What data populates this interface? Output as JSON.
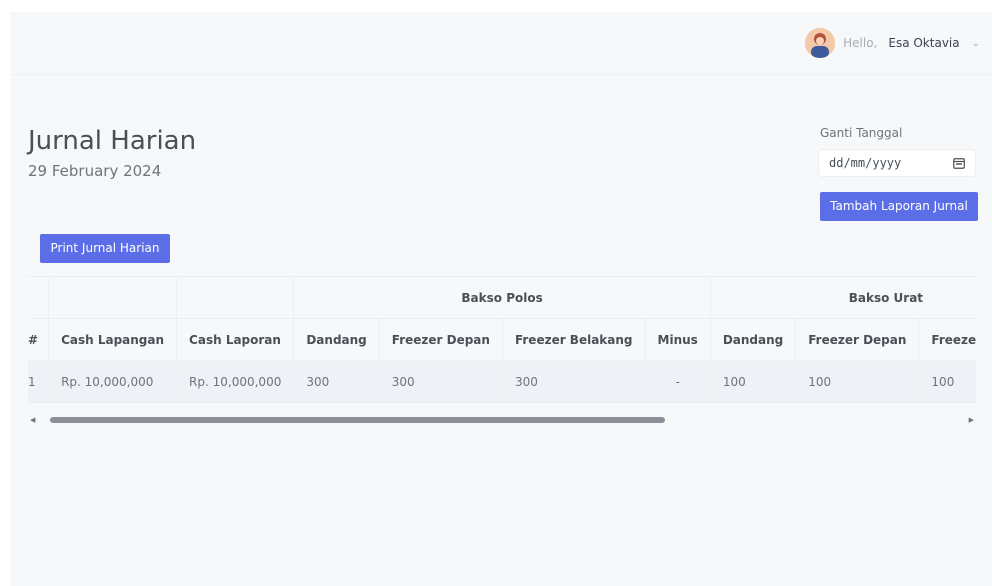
{
  "header": {
    "greeting": "Hello,",
    "username": "Esa Oktavia"
  },
  "page": {
    "title": "Jurnal Harian",
    "date": "29 February 2024"
  },
  "date_picker": {
    "label": "Ganti Tanggal",
    "placeholder": "dd/mm/yyyy"
  },
  "buttons": {
    "add_report": "Tambah Laporan Jurnal",
    "print": "Print Jurnal Harian"
  },
  "table": {
    "groups": [
      "Bakso Polos",
      "Bakso Urat"
    ],
    "columns": [
      "#",
      "Cash Lapangan",
      "Cash Laporan",
      "Dandang",
      "Freezer Depan",
      "Freezer Belakang",
      "Minus",
      "Dandang",
      "Freezer Depan",
      "Freezer Belakang"
    ],
    "rows": [
      [
        "1",
        "Rp. 10,000,000",
        "Rp. 10,000,000",
        "300",
        "300",
        "300",
        "-",
        "100",
        "100",
        "100"
      ]
    ]
  },
  "icons": {
    "calendar": "calendar-icon",
    "chevron": "chevron-down-icon",
    "scroll_left": "scroll-left-arrow-icon",
    "scroll_right": "scroll-right-arrow-icon"
  },
  "colors": {
    "primary": "#5b6ee7",
    "background": "#f7f8fa"
  },
  "scroll_position": 0
}
